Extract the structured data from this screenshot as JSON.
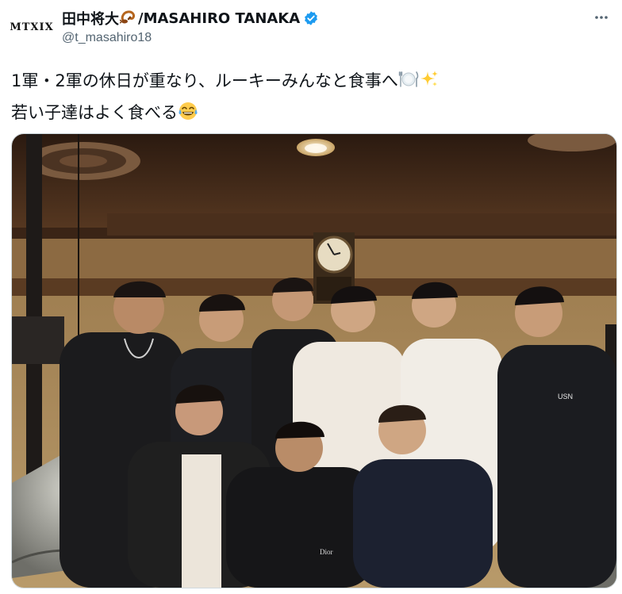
{
  "author": {
    "display_name": "田中将大",
    "display_name_suffix": "/MASAHIRO TANAKA",
    "handle": "@t_masahiro18",
    "avatar_text": "MTXIX",
    "verified": true
  },
  "tweet": {
    "line1": "1軍・2軍の休日が重なり、ルーキーみんなと食事へ",
    "line2": "若い子達はよく食べる"
  },
  "icons": {
    "name_emoji": "scorpion-icon",
    "verified": "verified-badge-icon",
    "more": "more-icon",
    "line1_emojis": [
      "fork-knife-plate-icon",
      "sparkles-icon"
    ],
    "line2_emoji": "tears-of-joy-icon"
  },
  "media": {
    "type": "photo"
  },
  "colors": {
    "verified": "#1d9bf0",
    "text": "#0f1419",
    "secondary": "#536471"
  }
}
